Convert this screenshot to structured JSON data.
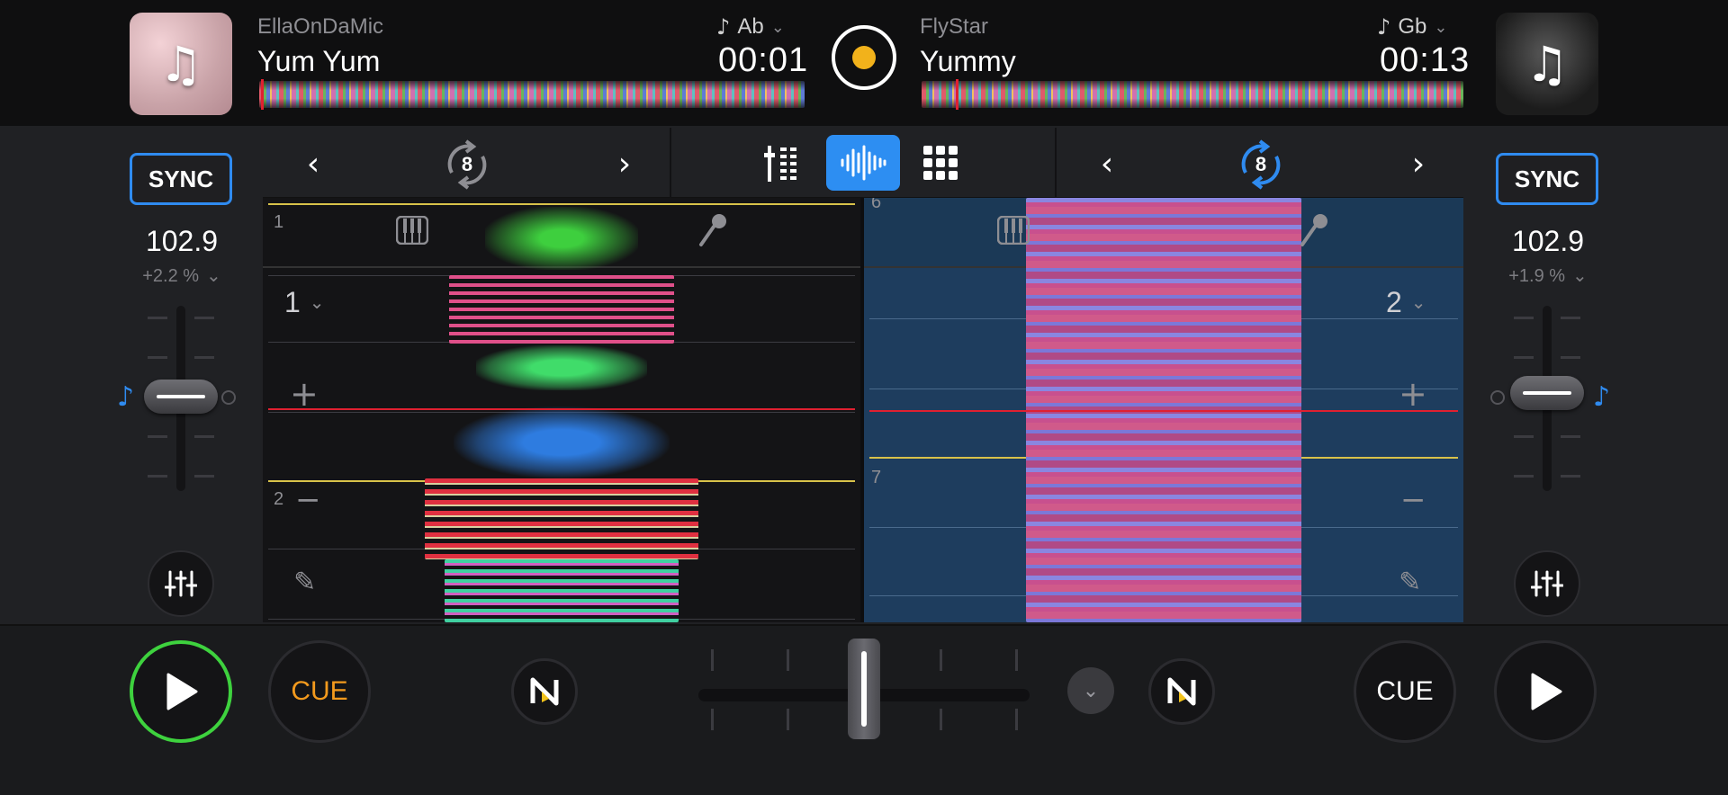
{
  "deck_a": {
    "artist": "EllaOnDaMic",
    "title": "Yum Yum",
    "key": "Ab",
    "time": "00:01",
    "sync_label": "SYNC",
    "bpm": "102.9",
    "pitch": "+2.2 %",
    "loop_size": "8",
    "deck_number": "1",
    "beat_marker_top": "1",
    "beat_marker_bottom": "2",
    "cue_label": "CUE"
  },
  "deck_b": {
    "artist": "FlyStar",
    "title": "Yummy",
    "key": "Gb",
    "time": "00:13",
    "sync_label": "SYNC",
    "bpm": "102.9",
    "pitch": "+1.9 %",
    "loop_size": "8",
    "deck_number": "2",
    "beat_marker_top": "6",
    "beat_marker_bottom": "7",
    "cue_label": "CUE"
  },
  "colors": {
    "accent": "#2f8bf0",
    "record_dot": "#f2b21b",
    "play_active": "#3ed23e",
    "cue_a": "#f39a1d",
    "cue_b": "#ffffff",
    "playhead": "#e02030",
    "downbeat": "#d8c24a"
  },
  "icons": {
    "key_icon": "music-note",
    "mode_mixer": "mixer-icon",
    "mode_waveform": "waveform-icon",
    "mode_pads": "grid-icon",
    "keys_icon": "piano-icon",
    "vocal_icon": "microphone-icon",
    "edit_icon": "pencil-icon"
  },
  "crossfader": {
    "position": 0.5
  }
}
